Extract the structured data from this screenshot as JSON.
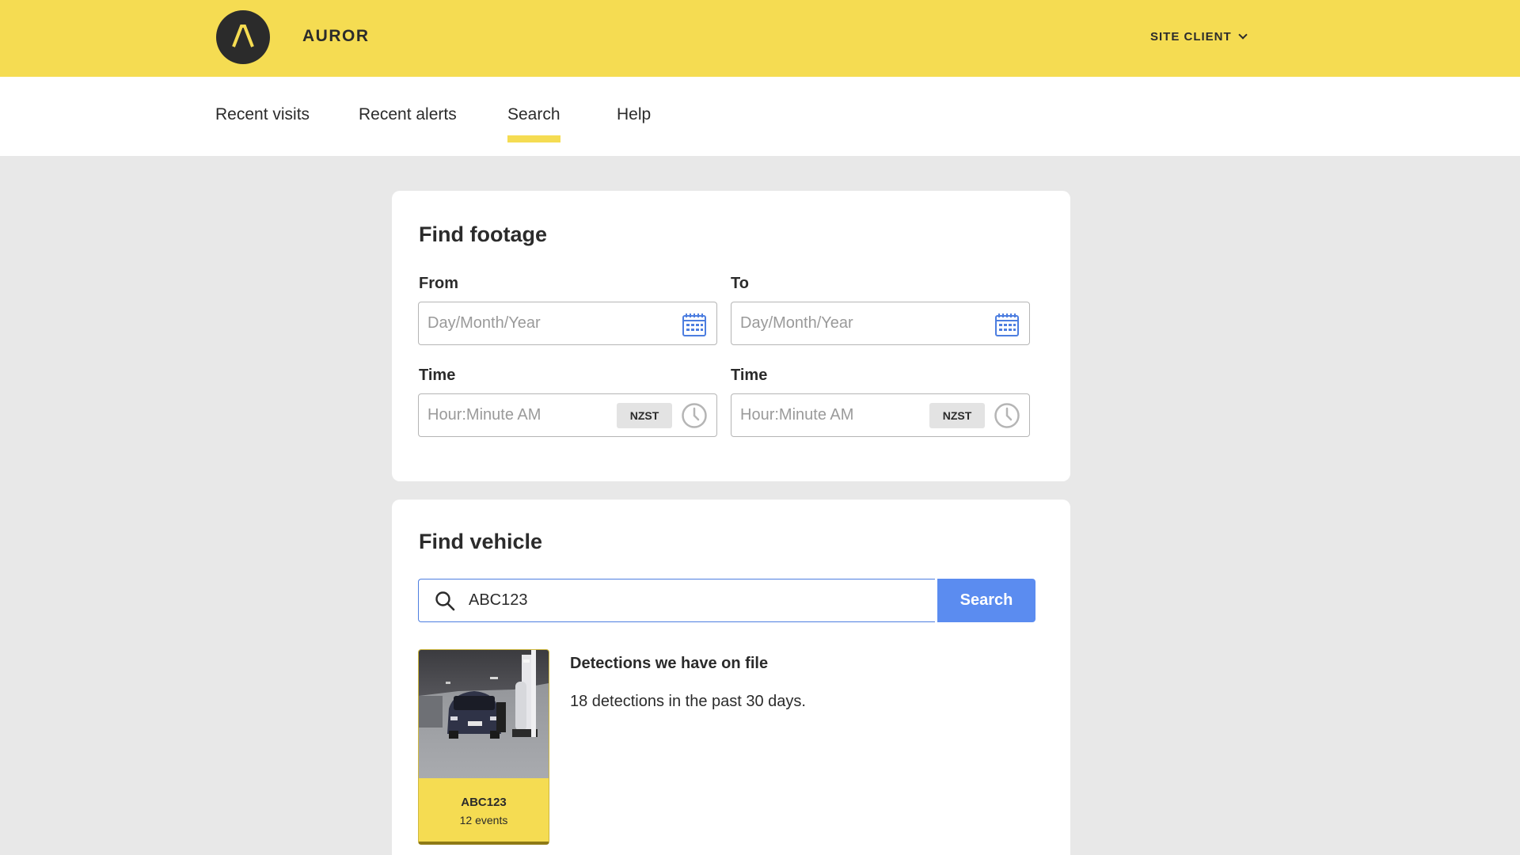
{
  "brand": {
    "name": "AUROR"
  },
  "header": {
    "account_label": "SITE CLIENT"
  },
  "nav": {
    "items": [
      {
        "label": "Recent visits"
      },
      {
        "label": "Recent alerts"
      },
      {
        "label": "Search",
        "active": true
      },
      {
        "label": "Help"
      }
    ]
  },
  "find_footage": {
    "title": "Find footage",
    "from": {
      "label": "From",
      "placeholder": "Day/Month/Year",
      "icon": "calendar-icon"
    },
    "to": {
      "label": "To",
      "placeholder": "Day/Month/Year",
      "icon": "calendar-icon"
    },
    "from_time": {
      "label": "Time",
      "placeholder": "Hour:Minute AM",
      "timezone": "NZST",
      "icon": "clock-icon"
    },
    "to_time": {
      "label": "Time",
      "placeholder": "Hour:Minute AM",
      "timezone": "NZST",
      "icon": "clock-icon"
    }
  },
  "find_vehicle": {
    "title": "Find vehicle",
    "search": {
      "value": "ABC123",
      "button_label": "Search",
      "icon": "search-icon"
    },
    "result": {
      "plate": "ABC123",
      "events": "12 events",
      "heading": "Detections we have on file",
      "summary": "18 detections in the past 30 days."
    }
  },
  "colors": {
    "brand_yellow": "#f5dc52",
    "accent_blue": "#5b8cf0",
    "page_background": "#e8e8e8",
    "text_dark": "#2b2b2b"
  }
}
